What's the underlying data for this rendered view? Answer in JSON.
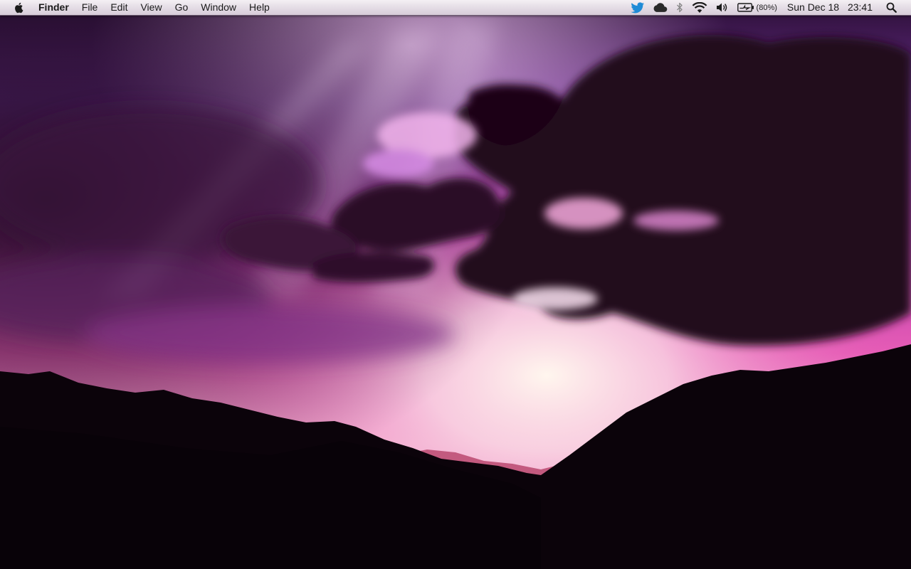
{
  "menubar": {
    "app_name": "Finder",
    "menus": [
      "File",
      "Edit",
      "View",
      "Go",
      "Window",
      "Help"
    ],
    "status": {
      "icons": [
        "twitter-icon",
        "cloud-icon",
        "bluetooth-icon",
        "wifi-icon",
        "volume-icon",
        "battery-charging-icon"
      ],
      "battery_percent": "(80%)",
      "date": "Sun Dec 18",
      "time": "23:41",
      "search_icon": "spotlight-search-icon"
    }
  },
  "colors": {
    "sky_pink": "#e05ab8",
    "sky_purple": "#7a2f9a",
    "glow": "#ffe9f2",
    "cloud_dark": "#26091f",
    "mountains": "#0b030a",
    "twitter_blue": "#1f8bd6"
  }
}
